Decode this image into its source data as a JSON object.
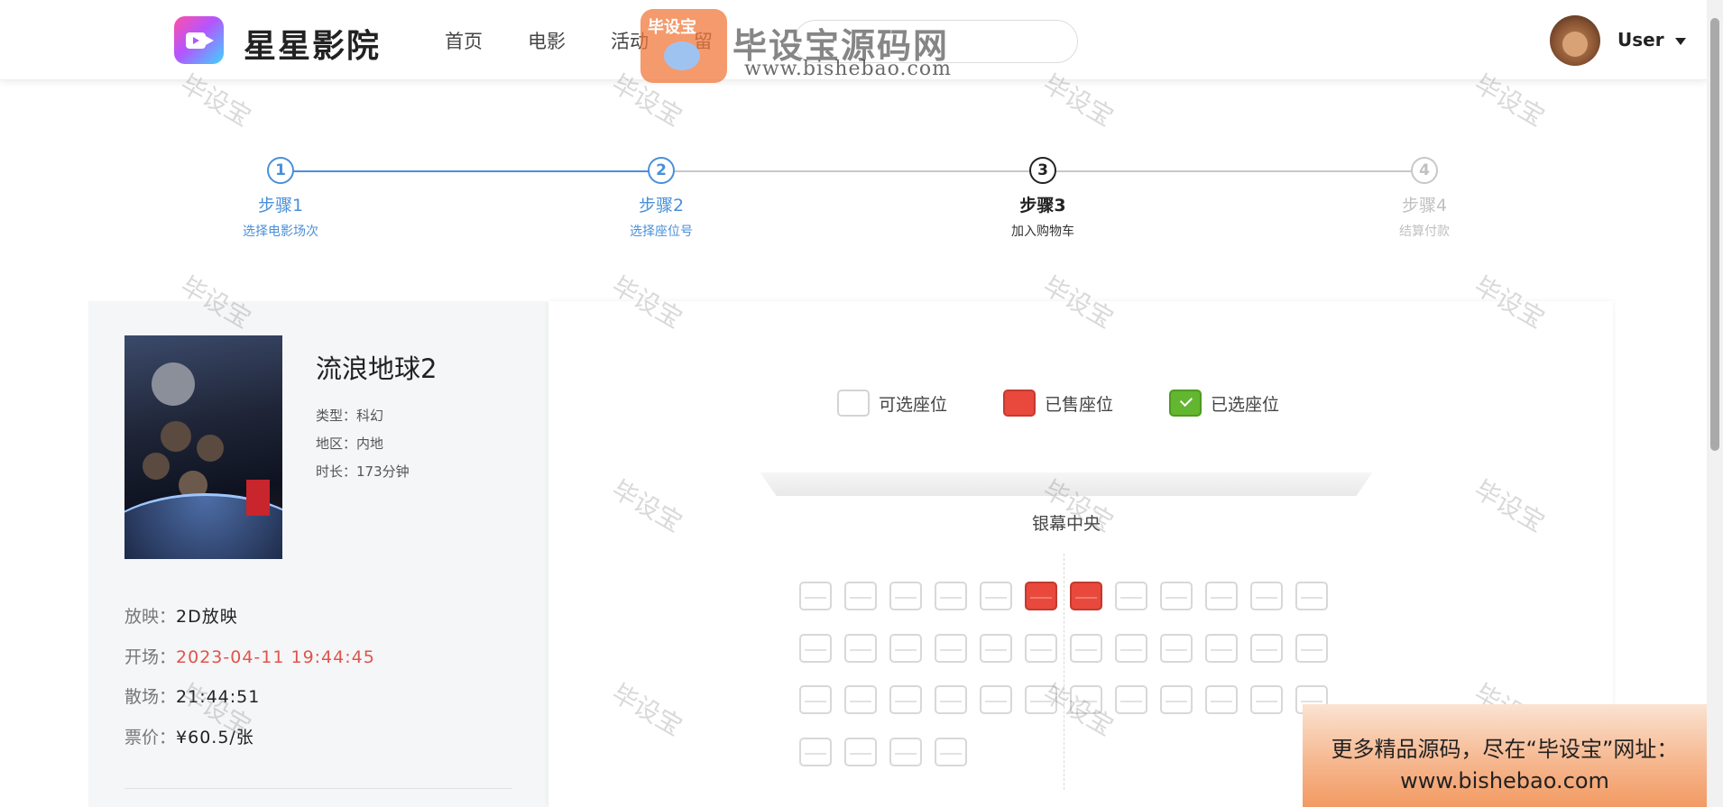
{
  "header": {
    "site_title": "星星影院",
    "nav": [
      "首页",
      "电影",
      "活动",
      "留"
    ],
    "user_name": "User"
  },
  "steps": [
    {
      "number": "1",
      "title": "步骤1",
      "desc": "选择电影场次",
      "state": "done"
    },
    {
      "number": "2",
      "title": "步骤2",
      "desc": "选择座位号",
      "state": "done"
    },
    {
      "number": "3",
      "title": "步骤3",
      "desc": "加入购物车",
      "state": "current"
    },
    {
      "number": "4",
      "title": "步骤4",
      "desc": "结算付款",
      "state": "pending"
    }
  ],
  "movie": {
    "name": "流浪地球2",
    "type_label": "类型：",
    "type": "科幻",
    "region_label": "地区：",
    "region": "内地",
    "duration_label": "时长：",
    "duration": "173分钟",
    "format_label": "放映：",
    "format": "2D放映",
    "start_label": "开场：",
    "start": "2023-04-11 19:44:45",
    "end_label": "散场：",
    "end": "21:44:51",
    "price_label": "票价：",
    "price": "¥60.5/张"
  },
  "legend": {
    "available": "可选座位",
    "sold": "已售座位",
    "selected": "已选座位"
  },
  "screen_label": "银幕中央",
  "seats": {
    "rows": [
      [
        "a",
        "a",
        "a",
        "a",
        "a",
        "s",
        "s",
        "a",
        "a",
        "a",
        "a",
        "a"
      ],
      [
        "a",
        "a",
        "a",
        "a",
        "a",
        "a",
        "a",
        "a",
        "a",
        "a",
        "a",
        "a"
      ],
      [
        "a",
        "a",
        "a",
        "a",
        "a",
        "a",
        "a",
        "a",
        "a",
        "a",
        "a",
        "a"
      ],
      [
        "a",
        "a",
        "a",
        "a"
      ]
    ]
  },
  "watermark": {
    "text": "毕设宝",
    "logo_text": "毕设宝",
    "title": "毕设宝源码网",
    "url": "www.bishebao.com"
  },
  "promo": {
    "line1": "更多精品源码，尽在“毕设宝”网址：",
    "line2": "www.bishebao.com"
  },
  "colors": {
    "accent_blue": "#4a90d9",
    "sold_red": "#e8493c",
    "selected_green": "#63b62f",
    "time_red": "#e0544c"
  }
}
